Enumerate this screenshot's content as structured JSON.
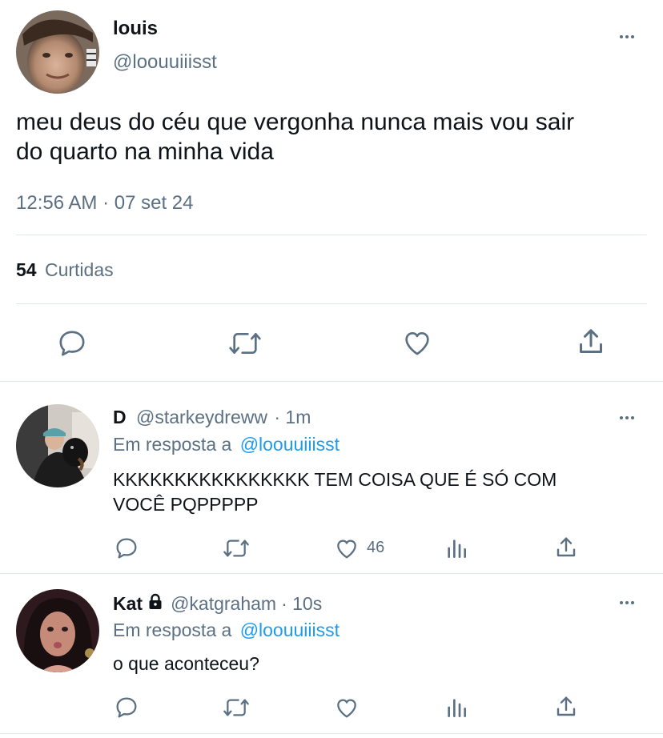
{
  "main_tweet": {
    "display_name": "louis",
    "handle": "@loouuiiisst",
    "text_line1": "meu deus do céu que vergonha nunca mais vou sair",
    "text_line2": "do quarto na minha vida",
    "timestamp": "12:56 AM · 07 set 24",
    "likes_count": "54",
    "likes_label": "Curtidas",
    "icons": [
      "reply-icon",
      "retweet-icon",
      "like-icon",
      "share-icon"
    ]
  },
  "replies": [
    {
      "display_name": "D",
      "handle": "@starkeydreww",
      "time": "· 1m",
      "reply_prefix": "Em resposta a",
      "reply_to": "@loouuiiisst",
      "text_line1": "KKKKKKKKKKKKKKKK TEM COISA QUE É SÓ COM",
      "text_line2": "VOCÊ PQPPPPP",
      "like_count": "46",
      "icons": [
        "reply-icon",
        "retweet-icon",
        "like-icon",
        "analytics-icon",
        "share-icon"
      ]
    },
    {
      "display_name": "Kat",
      "handle": "@katgraham",
      "time": "· 10s",
      "reply_prefix": "Em resposta a",
      "reply_to": "@loouuiiisst",
      "text_line1": "o que aconteceu?",
      "locked": true,
      "icons": [
        "reply-icon",
        "retweet-icon",
        "like-icon",
        "analytics-icon",
        "share-icon"
      ]
    }
  ],
  "colors": {
    "text": "#0f1419",
    "muted": "#5b7083",
    "link": "#1d9bf0",
    "divider": "#e1e8ed"
  }
}
